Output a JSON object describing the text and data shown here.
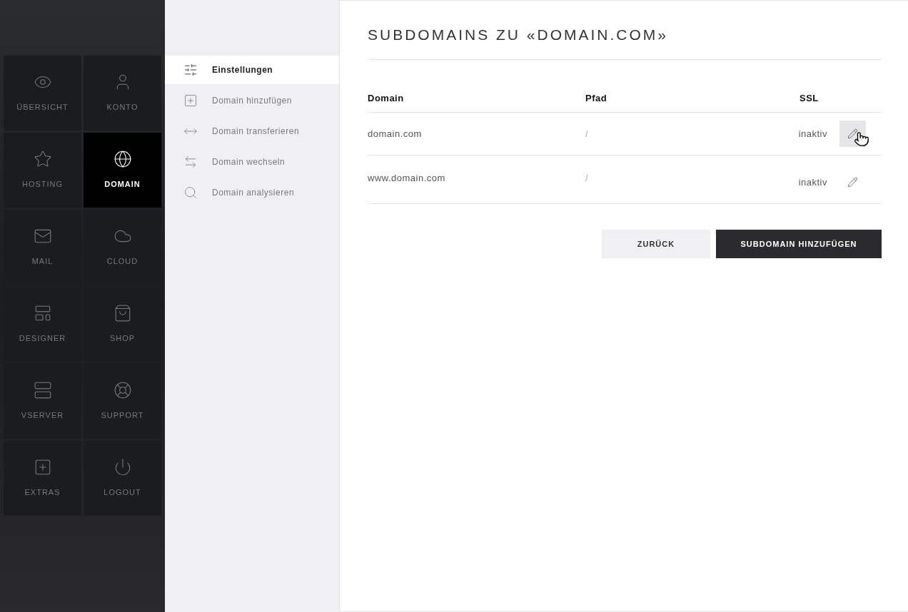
{
  "main_nav": [
    {
      "label": "ÜBERSICHT",
      "selected": false
    },
    {
      "label": "KONTO",
      "selected": false
    },
    {
      "label": "HOSTING",
      "selected": false
    },
    {
      "label": "DOMAIN",
      "selected": true
    },
    {
      "label": "MAIL",
      "selected": false
    },
    {
      "label": "CLOUD",
      "selected": false
    },
    {
      "label": "DESIGNER",
      "selected": false
    },
    {
      "label": "SHOP",
      "selected": false
    },
    {
      "label": "VSERVER",
      "selected": false
    },
    {
      "label": "SUPPORT",
      "selected": false
    },
    {
      "label": "EXTRAS",
      "selected": false
    },
    {
      "label": "LOGOUT",
      "selected": false
    }
  ],
  "sub_nav": [
    {
      "label": "Einstellungen",
      "selected": true
    },
    {
      "label": "Domain hinzufügen",
      "selected": false
    },
    {
      "label": "Domain transferieren",
      "selected": false
    },
    {
      "label": "Domain wechseln",
      "selected": false
    },
    {
      "label": "Domain analysieren",
      "selected": false
    }
  ],
  "title": "SUBDOMAINS ZU «DOMAIN.COM»",
  "table": {
    "columns": [
      "Domain",
      "Pfad",
      "SSL"
    ],
    "rows": [
      {
        "domain": "domain.com",
        "path": "/",
        "ssl": "inaktiv",
        "hovered": true
      },
      {
        "domain": "www.domain.com",
        "path": "/",
        "ssl": "inaktiv",
        "hovered": false
      }
    ]
  },
  "buttons": [
    {
      "label": "ZURÜCK",
      "kind": "secondary"
    },
    {
      "label": "SUBDOMAIN HINZUFÜGEN",
      "kind": "primary"
    }
  ]
}
